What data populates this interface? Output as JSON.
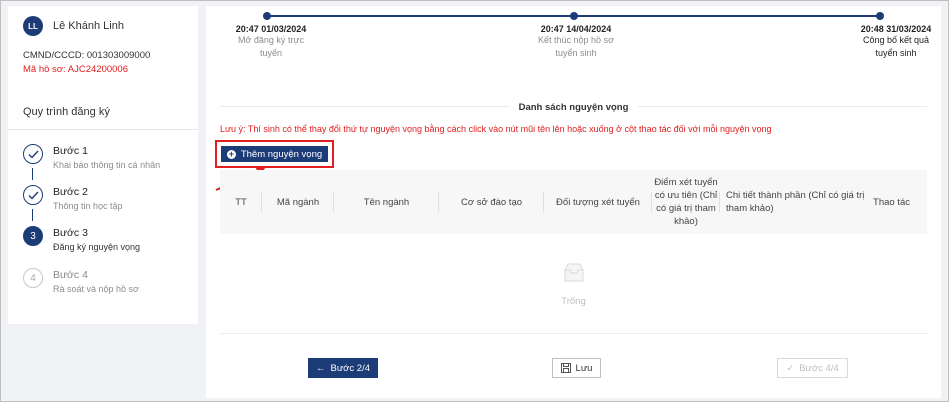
{
  "user": {
    "initials": "LL",
    "name": "Lê Khánh Linh",
    "id_label": "CMND/CCCD: 001303009000",
    "code_label": "Mã hồ sơ: AJC24200006"
  },
  "process": {
    "title": "Quy trình đăng ký",
    "steps": [
      {
        "title": "Bước 1",
        "subtitle": "Khai báo thông tin cá nhân",
        "status": "done",
        "icon": "check-icon"
      },
      {
        "title": "Bước 2",
        "subtitle": "Thông tin học tập",
        "status": "done",
        "icon": "check-icon"
      },
      {
        "title": "Bước 3",
        "subtitle": "Đăng ký nguyện vọng",
        "status": "active",
        "number": "3"
      },
      {
        "title": "Bước 4",
        "subtitle": "Rà soát và nộp hồ sơ",
        "status": "pending",
        "number": "4"
      }
    ]
  },
  "timeline": [
    {
      "date": "20:47 01/03/2024",
      "text_1": "Mở đăng ký trực",
      "text_2": "tuyến"
    },
    {
      "date": "20:47 14/04/2024",
      "text_1": "Kết thúc nộp hồ sơ",
      "text_2": "tuyển sinh"
    },
    {
      "date": "20:48 31/03/2024",
      "text_1": "Công bố kết quả",
      "text_2": "tuyển sinh"
    }
  ],
  "main": {
    "section_title": "Danh sách nguyện vọng",
    "note": "Lưu ý: Thí sinh có thể thay đổi thứ tự nguyện vọng bằng cách click vào nút mũi tên lên hoặc xuống ở cột thao tác đối với mỗi nguyện vọng",
    "add_button": "Thêm nguyện vọng",
    "table_headers": {
      "tt": "TT",
      "ma_nganh": "Mã ngành",
      "ten_nganh": "Tên ngành",
      "co_so": "Cơ sở đào tạo",
      "doi_tuong": "Đối tượng xét tuyển",
      "diem_1": "Điểm xét tuyển",
      "diem_2": "có ưu tiên (Chỉ",
      "diem_3": "có giá trị tham",
      "diem_4": "khảo)",
      "chi_tiet_1": "Chi tiết thành phần (Chỉ có giá trị",
      "chi_tiet_2": "tham khảo)",
      "thao_tac": "Thao tác"
    },
    "empty_text": "Trống"
  },
  "footer": {
    "back_label": "Bước 2/4",
    "save_label": "Lưu",
    "next_label": "Bước 4/4"
  },
  "colors": {
    "primary": "#1c3c78",
    "danger": "#e02020"
  }
}
